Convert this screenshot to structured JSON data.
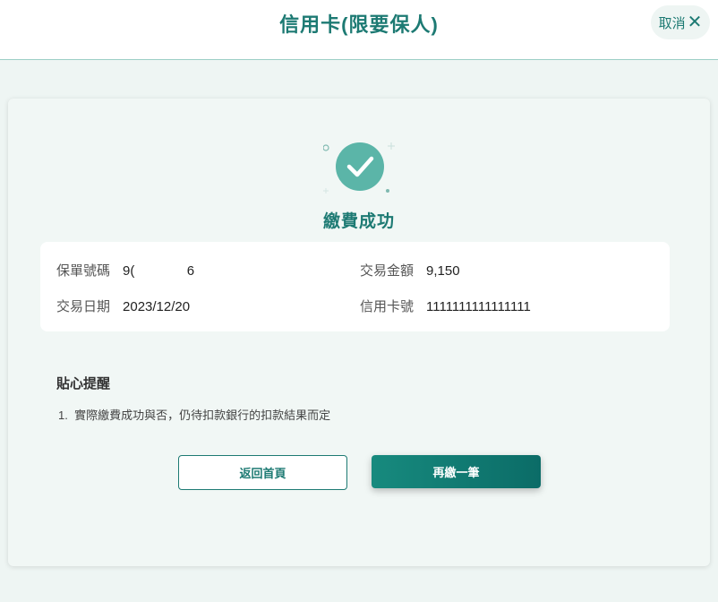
{
  "header": {
    "title": "信用卡(限要保人)",
    "cancel_label": "取消",
    "cancel_icon": "close-icon"
  },
  "result": {
    "icon": "check-circle-icon",
    "title": "繳費成功"
  },
  "details": {
    "policy_no_label": "保單號碼",
    "policy_no_value": "9(              6",
    "amount_label": "交易金額",
    "amount_value": "9,150",
    "date_label": "交易日期",
    "date_value": "2023/12/20",
    "card_label": "信用卡號",
    "card_value": "1111111111111111"
  },
  "reminder": {
    "title": "貼心提醒",
    "items": [
      "1.  實際繳費成功與否，仍待扣款銀行的扣款結果而定"
    ]
  },
  "actions": {
    "home_label": "返回首頁",
    "again_label": "再繳一筆"
  },
  "colors": {
    "primary": "#1d7a73",
    "background": "#eef5f3",
    "check_circle": "#5bb5a8"
  }
}
